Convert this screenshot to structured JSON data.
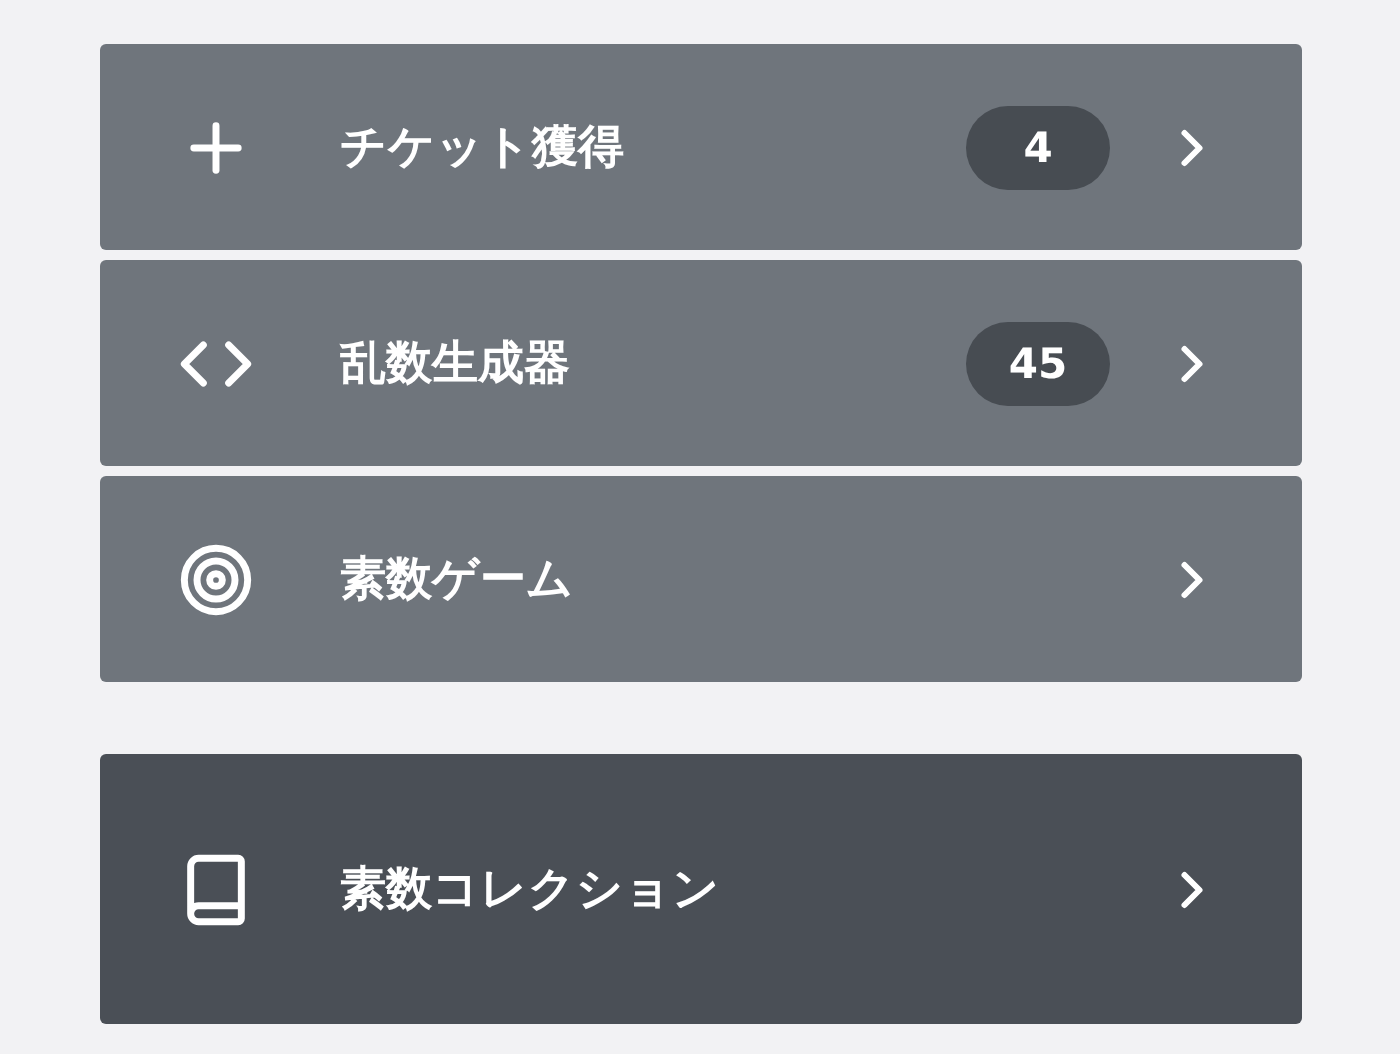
{
  "groups": [
    {
      "kind": "light",
      "items": [
        {
          "kind": "plus",
          "label": "チケット獲得",
          "badge": "4"
        },
        {
          "kind": "code",
          "label": "乱数生成器",
          "badge": "45"
        },
        {
          "kind": "target",
          "label": "素数ゲーム"
        }
      ]
    },
    {
      "kind": "dark",
      "items": [
        {
          "kind": "book",
          "label": "素数コレクション"
        }
      ]
    }
  ]
}
